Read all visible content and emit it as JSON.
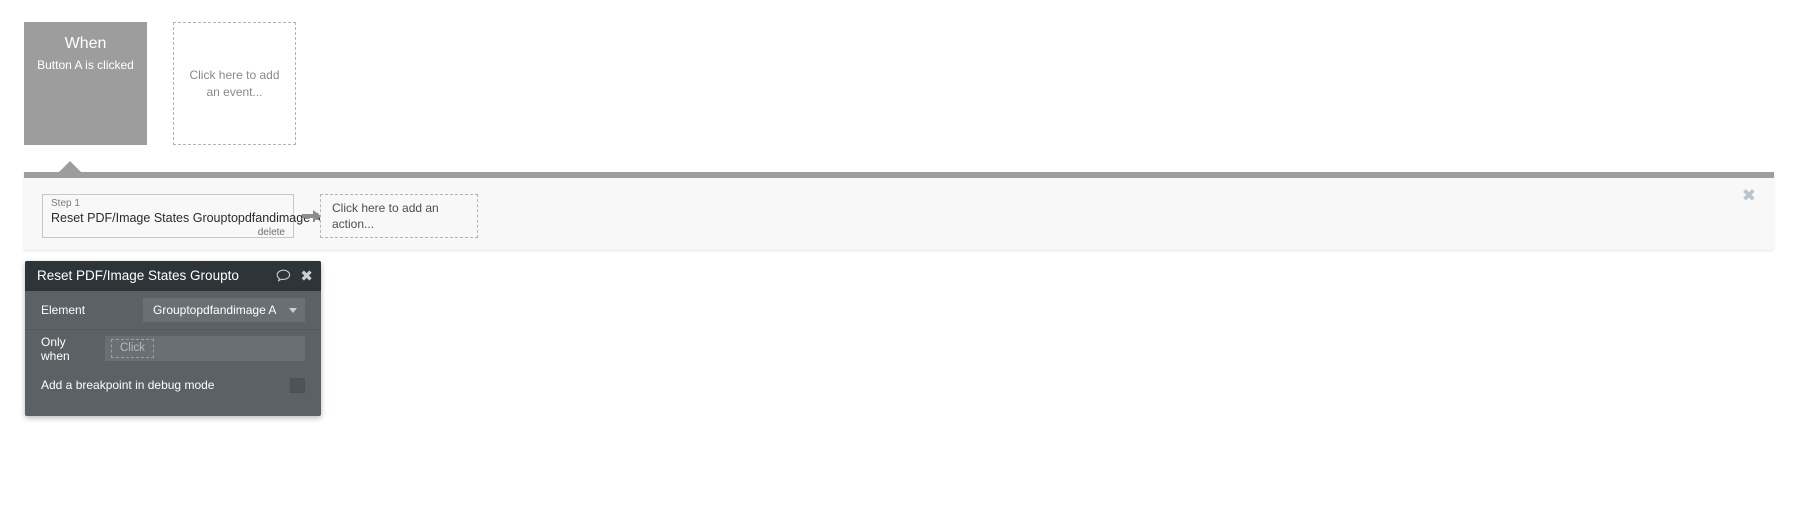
{
  "event_card": {
    "title": "When",
    "subtitle": "Button A is clicked",
    "bg_color": "#9d9d9d"
  },
  "add_event_card": {
    "placeholder": "Click here to add an event..."
  },
  "actions_panel": {
    "close_icon": "✖",
    "step": {
      "label": "Step 1",
      "title": "Reset PDF/Image States Grouptopdfandimage A",
      "delete_label": "delete"
    },
    "add_action": {
      "placeholder": "Click here to add an action..."
    }
  },
  "property_editor": {
    "title": "Reset PDF/Image States Groupto",
    "comment_icon": "comment-icon",
    "close_icon": "✖",
    "element_row": {
      "label": "Element",
      "value": "Grouptopdfandimage A"
    },
    "only_when_row": {
      "label": "Only when",
      "placeholder": "Click"
    },
    "breakpoint_row": {
      "label": "Add a breakpoint in debug mode",
      "checked": false
    },
    "header_bg": "#2e3538",
    "body_bg": "#5b6164"
  }
}
